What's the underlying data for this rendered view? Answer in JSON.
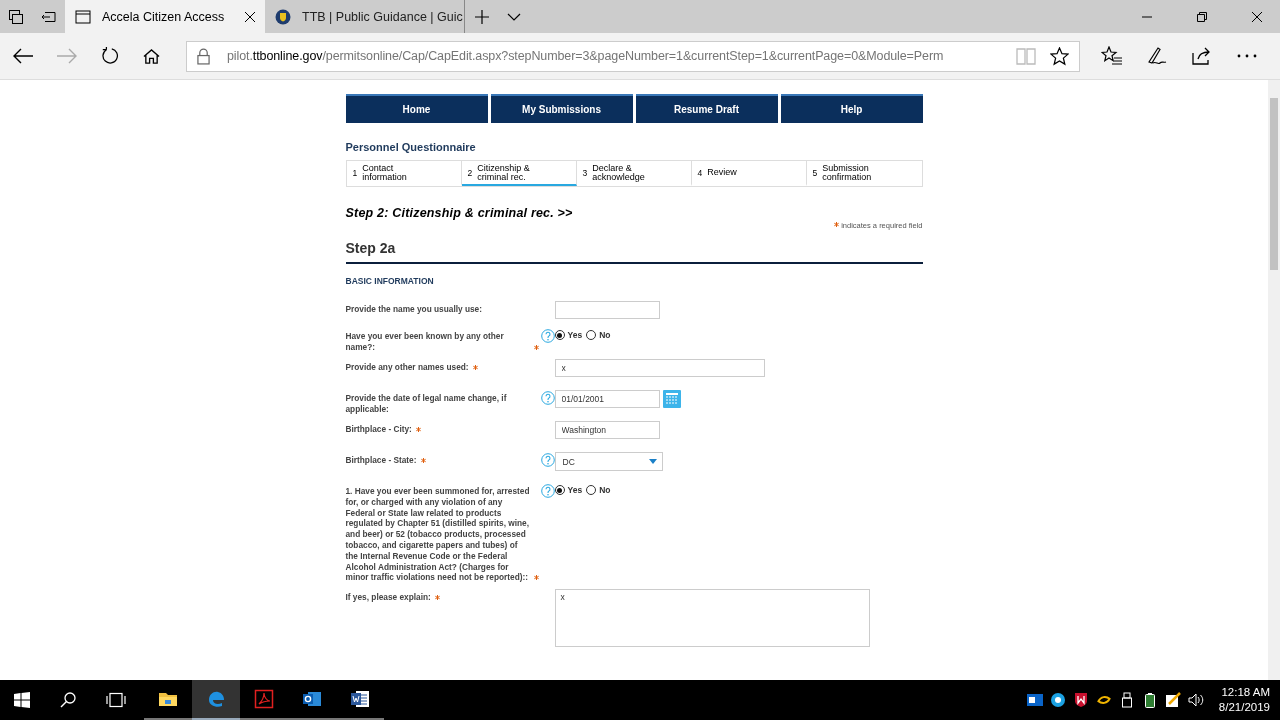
{
  "browser": {
    "tabs": [
      {
        "title": "Accela Citizen Access",
        "selected": true,
        "kind": "page"
      },
      {
        "title": "TTB | Public Guidance | Guic",
        "selected": false,
        "kind": "seal"
      }
    ],
    "address": {
      "prefix": "pilot.",
      "host": "ttbonline.gov",
      "path": "/permitsonline/Cap/CapEdit.aspx?stepNumber=3&pageNumber=1&currentStep=1&currentPage=0&Module=Perm"
    }
  },
  "nav": [
    "Home",
    "My Submissions",
    "Resume Draft",
    "Help"
  ],
  "page_title": "Personnel Questionnaire",
  "steps": [
    {
      "number": "1",
      "label": "Contact information",
      "selected": false
    },
    {
      "number": "2",
      "label": "Citizenship & criminal rec.",
      "selected": true
    },
    {
      "number": "3",
      "label": "Declare & acknowledge",
      "selected": false
    },
    {
      "number": "4",
      "label": "Review",
      "selected": false
    },
    {
      "number": "5",
      "label": "Submission confirmation",
      "selected": false
    }
  ],
  "step_heading": "Step 2: Citizenship & criminal rec. >>",
  "required_note": "indicates a required field",
  "section_title": "Step 2a",
  "subsection_title": "BASIC INFORMATION",
  "fields": [
    {
      "kind": "text",
      "label": "Provide the name you usually use:",
      "required": false,
      "help": false
    },
    {
      "kind": "radio",
      "label": "Have you ever been known by any other name?:",
      "required": true,
      "help": true,
      "options": [
        {
          "label": "Yes",
          "selected": true
        },
        {
          "label": "No",
          "selected": false
        }
      ]
    },
    {
      "kind": "wide",
      "label": "Provide any other names used:",
      "required": true,
      "help": false,
      "value": "x"
    },
    {
      "kind": "date",
      "label": "Provide the date of legal name change, if applicable:",
      "required": false,
      "help": true,
      "value": "01/01/2001"
    },
    {
      "kind": "text",
      "label": "Birthplace - City:",
      "required": true,
      "help": false,
      "value": "Washington"
    },
    {
      "kind": "select",
      "label": "Birthplace - State:",
      "required": true,
      "help": true,
      "value": "DC"
    },
    {
      "kind": "radio",
      "label": "1. Have you ever been summoned for, arrested for, or charged with any violation of any Federal or State law related to products regulated by Chapter 51 (distilled spirits, wine, and beer) or 52 (tobacco products, processed tobacco, and cigarette papers and tubes) of the Internal Revenue Code or the Federal Alcohol Administration Act? (Charges for minor traffic violations need not be reported)::",
      "required": true,
      "help": true,
      "options": [
        {
          "label": "Yes",
          "selected": true
        },
        {
          "label": "No",
          "selected": false
        }
      ]
    },
    {
      "kind": "textarea",
      "label": "If yes, please explain:",
      "required": true,
      "help": false,
      "value": "x"
    }
  ],
  "taskbar": {
    "apps": [
      {
        "kind": "folder",
        "selected": false
      },
      {
        "kind": "edge",
        "selected": true
      },
      {
        "kind": "pdf",
        "selected": false
      },
      {
        "kind": "mail",
        "selected": false
      },
      {
        "kind": "word",
        "selected": false
      }
    ],
    "time": "12:18 AM",
    "date": "8/21/2019"
  }
}
